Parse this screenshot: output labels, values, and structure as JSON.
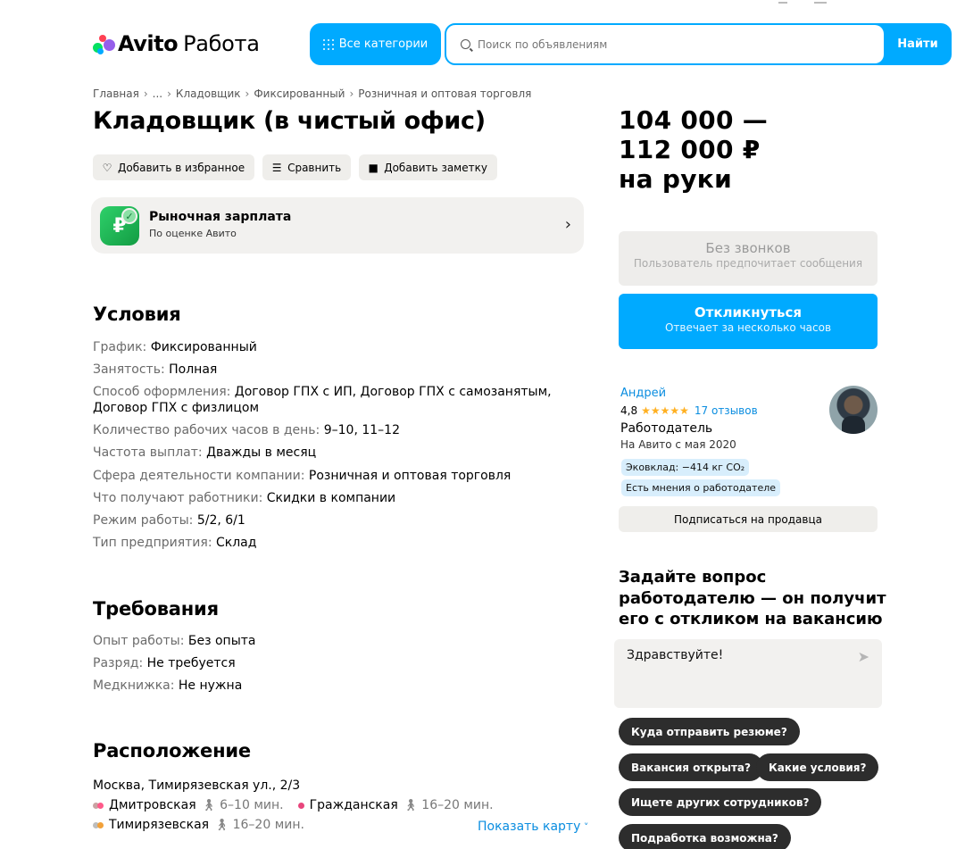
{
  "logo": {
    "brand": "Avito",
    "section": "Работа"
  },
  "header": {
    "categories_label": "Все категории",
    "search_placeholder": "Поиск по объявлениям",
    "search_button": "Найти"
  },
  "breadcrumbs": [
    "Главная",
    "...",
    "Кладовщик",
    "Фиксированный",
    "Розничная и оптовая торговля"
  ],
  "title": "Кладовщик (в чистый офис)",
  "actions": {
    "favorite": "Добавить в избранное",
    "compare": "Сравнить",
    "note": "Добавить заметку"
  },
  "market": {
    "title": "Рыночная зарплата",
    "subtitle": "По оценке Авито",
    "icon_symbol": "₽"
  },
  "conditions": {
    "heading": "Условия",
    "rows": [
      {
        "k": "График: ",
        "v": "Фиксированный"
      },
      {
        "k": "Занятость: ",
        "v": "Полная"
      },
      {
        "k": "Способ оформления: ",
        "v": "Договор ГПХ с ИП, Договор ГПХ с самозанятым, Договор ГПХ с физлицом"
      },
      {
        "k": "Количество рабочих часов в день: ",
        "v": "9–10, 11–12"
      },
      {
        "k": "Частота выплат: ",
        "v": "Дважды в месяц"
      },
      {
        "k": "Сфера деятельности компании: ",
        "v": "Розничная и оптовая торговля"
      },
      {
        "k": "Что получают работники: ",
        "v": "Скидки в компании"
      },
      {
        "k": "Режим работы: ",
        "v": "5/2, 6/1"
      },
      {
        "k": "Тип предприятия: ",
        "v": "Склад"
      }
    ]
  },
  "requirements": {
    "heading": "Требования",
    "rows": [
      {
        "k": "Опыт работы: ",
        "v": "Без опыта"
      },
      {
        "k": "Разряд: ",
        "v": "Не требуется"
      },
      {
        "k": "Медкнижка: ",
        "v": "Не нужна"
      }
    ]
  },
  "location": {
    "heading": "Расположение",
    "address": "Москва, Тимирязевская ул., 2/3",
    "stations": [
      {
        "name": "Дмитровская",
        "time": "6–10 мин.",
        "colors": [
          "#c9a3a3",
          "#ff5a8a"
        ]
      },
      {
        "name": "Гражданская",
        "time": "16–20 мин.",
        "colors": [
          "#e8457c"
        ]
      },
      {
        "name": "Тимирязевская",
        "time": "16–20 мин.",
        "colors": [
          "#bdbdbd",
          "#f2a13a"
        ]
      }
    ],
    "show_map": "Показать карту"
  },
  "salary": {
    "line1": "104 000 —",
    "line2": "112 000 ₽",
    "line3": "на руки"
  },
  "no_calls": {
    "title": "Без звонков",
    "subtitle": "Пользователь предпочитает сообщения"
  },
  "respond": {
    "title": "Откликнуться",
    "subtitle": "Отвечает за несколько часов"
  },
  "seller": {
    "name": "Андрей",
    "rating": "4,8",
    "stars": "★★★★★",
    "reviews": "17 отзывов",
    "role": "Работодатель",
    "since": "На Авито с мая 2020",
    "tags": [
      "Эковклад: −414 кг CO₂",
      "Есть мнения о работодателе"
    ],
    "subscribe": "Подписаться на продавца"
  },
  "ask": {
    "title": "Задайте вопрос работодателю — он получит его с откликом на вакансию",
    "message": "Здравствуйте!",
    "chips": [
      "Куда отправить резюме?",
      "Вакансия открыта?",
      "Какие условия?",
      "Ищете других сотрудников?",
      "Подработка возможна?"
    ]
  },
  "colors": {
    "accent": "#00aaff",
    "link": "#0a8de0",
    "chip": "#2d2d2d",
    "star": "#ffb021"
  }
}
